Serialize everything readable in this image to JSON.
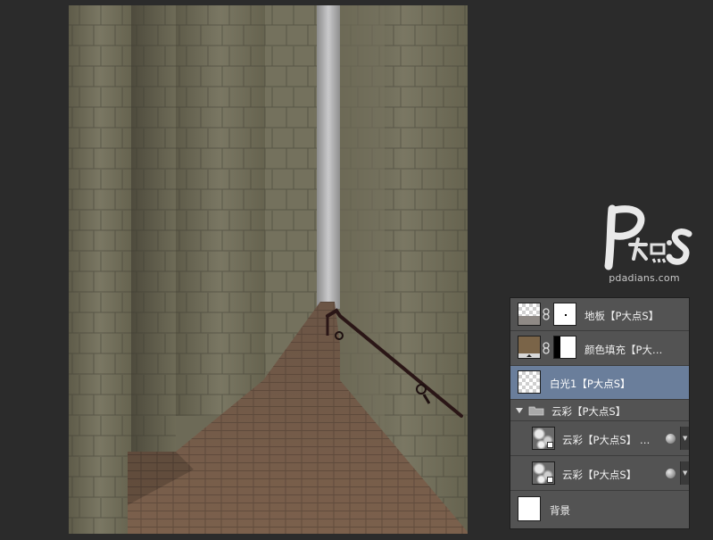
{
  "watermark": {
    "brand": "pdadians.com"
  },
  "layers_panel": {
    "layers": [
      {
        "name": "地板【P大点S】",
        "thumb": "checker-floor",
        "has_mask": true,
        "selected": false
      },
      {
        "name": "颜色填充【P大…",
        "thumb": "brown-fill",
        "has_mask": true,
        "selected": false
      },
      {
        "name": "白光1【P大点S】",
        "thumb": "checker",
        "has_mask": false,
        "selected": true
      },
      {
        "name": "云彩【P大点S】",
        "thumb": "folder",
        "group": true,
        "expanded": true,
        "selected": false
      },
      {
        "name": "云彩【P大点S】 …",
        "thumb": "cloud",
        "in_group": true,
        "has_fx": true,
        "selected": false
      },
      {
        "name": "云彩【P大点S】",
        "thumb": "cloud",
        "in_group": true,
        "has_fx": true,
        "selected": false
      },
      {
        "name": "背景",
        "thumb": "white",
        "selected": false
      }
    ]
  },
  "colors": {
    "app_bg": "#2b2b2b",
    "panel_bg": "#535353",
    "selected_row": "#6a7e9b",
    "fill_swatch": "#7a6448"
  }
}
